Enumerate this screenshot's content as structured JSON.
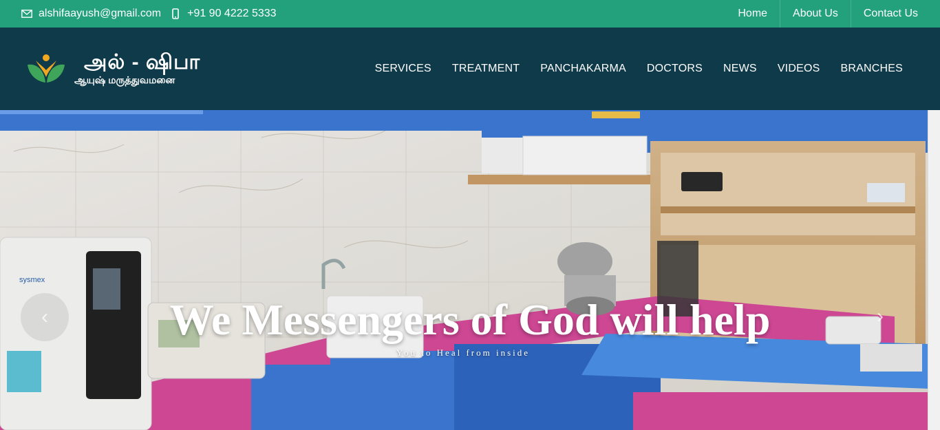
{
  "topbar": {
    "email": "alshifaayush@gmail.com",
    "phone": "+91 90 4222 5333",
    "email_icon": "mail-icon",
    "phone_icon": "phone-icon",
    "links": [
      "Home",
      "About Us",
      "Contact Us"
    ]
  },
  "header": {
    "logo_title": "அல் - ஷிபா",
    "logo_subtitle": "ஆயுஷ் மருத்துவமனை",
    "nav": [
      "SERVICES",
      "TREATMENT",
      "PANCHAKARMA",
      "DOCTORS",
      "NEWS",
      "VIDEOS",
      "BRANCHES"
    ]
  },
  "hero": {
    "title": "We Messengers of God will help",
    "subtitle": "You to Heal from inside",
    "prev_icon": "chevron-left-icon",
    "next_icon": "chevron-right-icon",
    "machine_brand": "sysmex"
  },
  "colors": {
    "topbar": "#23a17c",
    "header": "#0f3a4a",
    "counter_pink": "#d64a9a",
    "cabinet_blue": "#3d79d6"
  }
}
